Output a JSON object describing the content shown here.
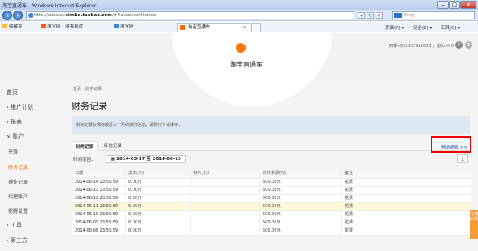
{
  "window": {
    "title": "淘宝直通车 - Windows Internet Explorer",
    "url_prefix": "http://subway.",
    "url_domain": "simba.taobao.com",
    "url_suffix": "/#!/account/finance",
    "search_placeholder": "Bing",
    "controls": [
      "–",
      "▢",
      "✕"
    ]
  },
  "favorites": {
    "label": "收藏夹",
    "items": [
      "淘宝网 - 淘我喜欢",
      "淘宝网"
    ]
  },
  "tab": {
    "label": "淘宝直通车",
    "close": "×"
  },
  "toolbar": [
    "页面(P) ▾",
    "安全(S) ▾",
    "工具(O) ▾"
  ],
  "header": {
    "logo_text": "淘宝直通车",
    "user_text": "四季e家(1105910613)，退出",
    "mail_count": "0"
  },
  "sidebar": {
    "items": [
      {
        "label": "首页"
      },
      {
        "label": "› 推广计划"
      },
      {
        "label": "› 报表"
      },
      {
        "label": "∨ 账户"
      },
      {
        "label": "充值"
      },
      {
        "label": "财务记录"
      },
      {
        "label": "操作记录"
      },
      {
        "label": "代理账户"
      },
      {
        "label": "提醒设置"
      },
      {
        "label": "› 工具"
      },
      {
        "label": "› 第三方"
      }
    ]
  },
  "main": {
    "breadcrumb": "首页 › 财务记录",
    "title": "财务记录",
    "notice": "财务记录仅保持最近三个月的操作信息，请及时下载保存。",
    "tabs": [
      "财务记录",
      "红包记录"
    ],
    "refund_link": "申请退款 >>",
    "date_label": "时间范围：",
    "date_range": "▦ 2014-03-17 至 2014-06-15",
    "download": "⤓"
  },
  "table": {
    "columns": [
      "日期",
      "支出(元)",
      "存入(元)",
      "日终余额(元)",
      "备注"
    ],
    "rows": [
      [
        "2014-06-14 23:59:59",
        "0.00元",
        "",
        "500.00元",
        "花费"
      ],
      [
        "2014-06-13 23:59:59",
        "0.00元",
        "",
        "500.00元",
        "花费"
      ],
      [
        "2014-06-12 23:59:59",
        "0.00元",
        "",
        "500.00元",
        "花费"
      ],
      [
        "2014-06-11 23:59:59",
        "0.00元",
        "",
        "500.00元",
        "花费"
      ],
      [
        "2014-06-10 23:59:59",
        "0.00元",
        "",
        "500.00元",
        "花费"
      ],
      [
        "2014-06-09 23:59:59",
        "0.00元",
        "",
        "500.00元",
        "花费"
      ],
      [
        "2014-06-08 23:59:59",
        "0.00元",
        "",
        "500.00元",
        "花费"
      ]
    ],
    "highlight_row": 3
  },
  "feedback_label": "在线反馈",
  "colors": {
    "accent": "#ff6a00",
    "notice_bg": "#dce8f3",
    "link": "#2a5db0",
    "highlight_box": "#e00000"
  }
}
